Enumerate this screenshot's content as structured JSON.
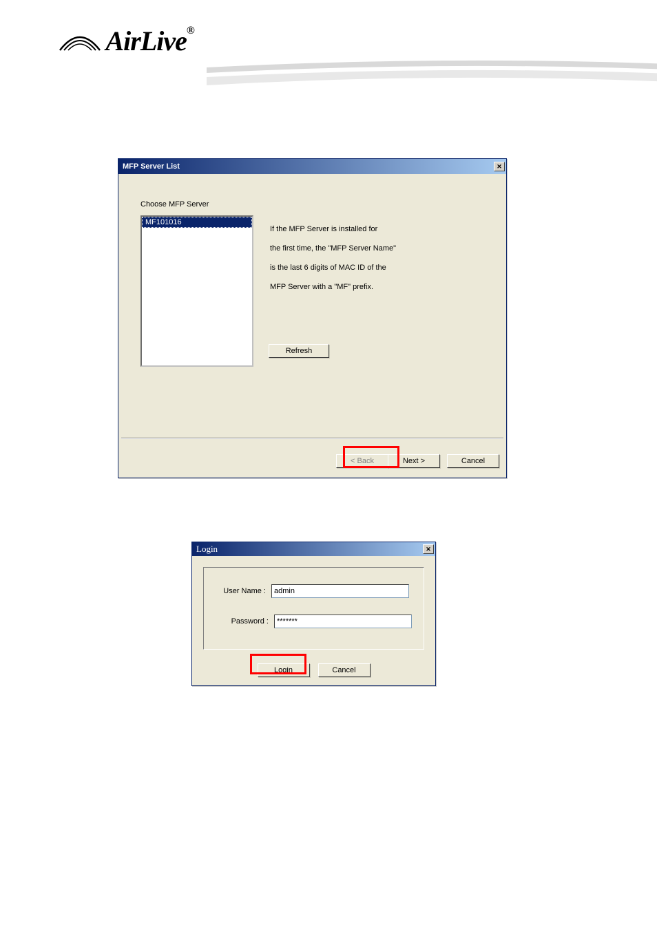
{
  "logo": {
    "text": "AirLive",
    "reg": "®"
  },
  "mfp": {
    "title": "MFP Server List",
    "choose_label": "Choose MFP Server",
    "server_item": "MF101016",
    "info_line1": "If the MFP Server is installed for",
    "info_line2": "the first time, the \"MFP Server Name\"",
    "info_line3": "is the last 6 digits of MAC ID of the",
    "info_line4": "MFP Server with a \"MF\" prefix.",
    "refresh": "Refresh",
    "back": "< Back",
    "next": "Next >",
    "cancel": "Cancel",
    "close_glyph": "✕"
  },
  "login": {
    "title": "Login",
    "user_label": "User Name :",
    "pass_label": "Password :",
    "user_value": "admin",
    "pass_value": "*******",
    "login_btn": "Login",
    "cancel_btn": "Cancel",
    "close_glyph": "✕"
  }
}
